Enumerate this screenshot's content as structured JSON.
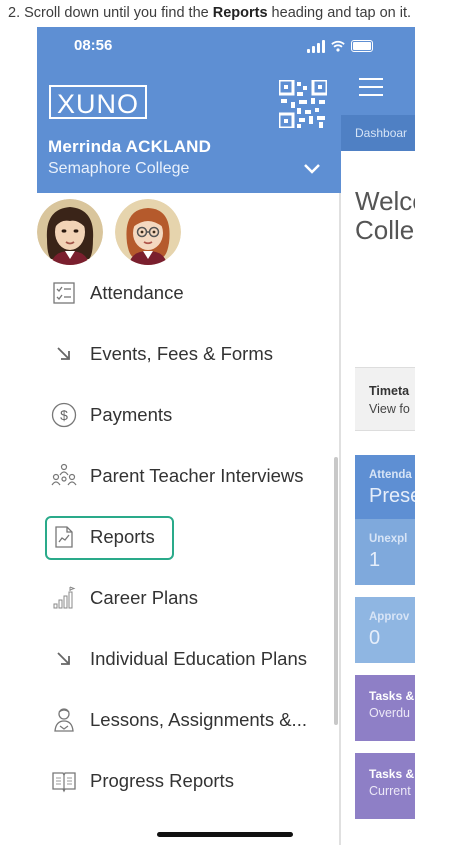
{
  "instruction": {
    "prefix": "2.  Scroll down until you find the ",
    "bold": "Reports",
    "suffix": " heading and tap on it."
  },
  "status_bar": {
    "time": "08:56"
  },
  "drawer": {
    "logo": "XUNO",
    "user_name": "Merrinda ACKLAND",
    "school": "Semaphore College",
    "menu": [
      {
        "label": "Attendance",
        "icon": "checklist-icon"
      },
      {
        "label": "Events, Fees & Forms",
        "icon": "arrow-down-right-icon"
      },
      {
        "label": "Payments",
        "icon": "dollar-coin-icon"
      },
      {
        "label": "Parent Teacher Interviews",
        "icon": "people-group-icon"
      },
      {
        "label": "Reports",
        "icon": "report-chart-icon",
        "highlighted": true
      },
      {
        "label": "Career Plans",
        "icon": "bar-growth-icon"
      },
      {
        "label": "Individual Education Plans",
        "icon": "arrow-down-right-icon"
      },
      {
        "label": "Lessons, Assignments &...",
        "icon": "student-icon"
      },
      {
        "label": "Progress Reports",
        "icon": "open-book-icon"
      }
    ]
  },
  "app": {
    "tab": "Dashboar",
    "welcome_line1": "Welco",
    "welcome_line2": "Colleg",
    "cards": [
      {
        "title": "Timeta",
        "value": "View fo"
      },
      {
        "title": "Attenda",
        "value": "Prese"
      },
      {
        "title": "Unexpl",
        "value": "1"
      },
      {
        "title": "Approv",
        "value": "0"
      },
      {
        "title": "Tasks &",
        "value": "Overdu"
      },
      {
        "title": "Tasks &",
        "value": "Current"
      }
    ]
  },
  "colors": {
    "header_blue": "#5e8fd3",
    "highlight_green": "#2aaa8a",
    "card_purple": "#8e7fc6"
  }
}
